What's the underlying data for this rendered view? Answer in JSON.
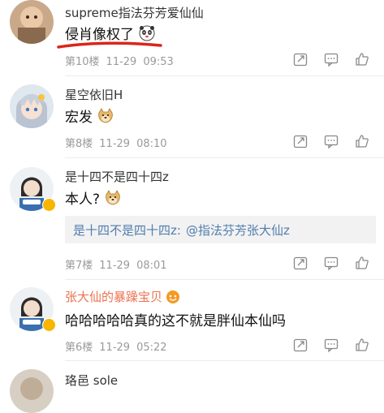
{
  "comments": [
    {
      "name": "supreme指法芬芳爱仙仙",
      "text": "侵肖像权了",
      "emoji": "panda-emoji",
      "floor": "第10楼",
      "date": "11-29",
      "time": "09:53"
    },
    {
      "name": "星空依旧H",
      "text": "宏发",
      "emoji": "doge-emoji",
      "floor": "第8楼",
      "date": "11-29",
      "time": "08:10"
    },
    {
      "name": "是十四不是四十四z",
      "text": "本人?",
      "emoji": "doge-emoji",
      "quote_user": "是十四不是四十四z:",
      "quote_text": "@指法芬芳张大仙z",
      "floor": "第7楼",
      "date": "11-29",
      "time": "08:01"
    },
    {
      "name": "张大仙的暴躁宝贝",
      "text": "哈哈哈哈哈真的这不就是胖仙本仙吗",
      "floor": "第6楼",
      "date": "11-29",
      "time": "05:22"
    },
    {
      "name": "珞邑 sole"
    }
  ],
  "colors": {
    "link_blue": "#507daf",
    "orange_name": "#eb7350",
    "meta_gray": "#9a9a9a",
    "vip_badge": "#f7b500",
    "underline_red": "#d9261c"
  },
  "icons": [
    "forward-icon",
    "comment-icon",
    "like-icon"
  ]
}
